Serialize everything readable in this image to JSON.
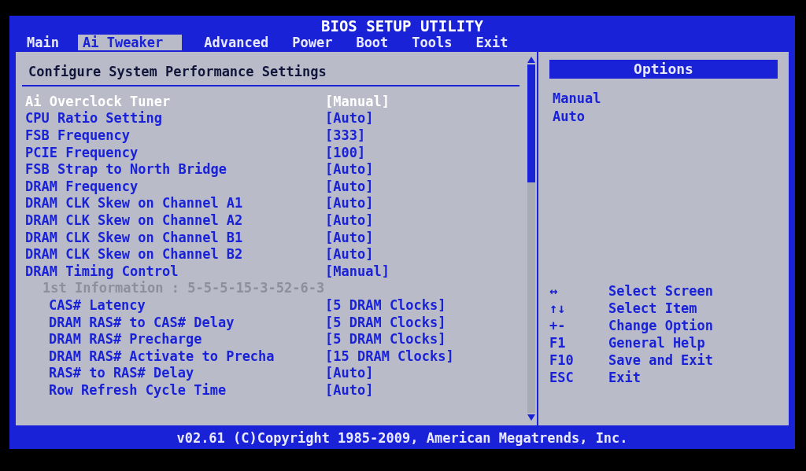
{
  "window": {
    "title": "BIOS SETUP UTILITY"
  },
  "tabs": [
    {
      "label": "Main",
      "selected": false
    },
    {
      "label": "Ai Tweaker",
      "selected": true
    },
    {
      "label": "Advanced",
      "selected": false
    },
    {
      "label": "Power",
      "selected": false
    },
    {
      "label": "Boot",
      "selected": false
    },
    {
      "label": "Tools",
      "selected": false
    },
    {
      "label": "Exit",
      "selected": false
    }
  ],
  "settings_panel": {
    "heading": "Configure System Performance Settings",
    "items": [
      {
        "kind": "setting",
        "label": "Ai Overclock Tuner",
        "value": "[Manual]",
        "selected": true
      },
      {
        "kind": "setting",
        "label": "CPU Ratio Setting",
        "value": "[Auto]",
        "selected": false
      },
      {
        "kind": "setting",
        "label": "FSB Frequency",
        "value": "[333]",
        "selected": false
      },
      {
        "kind": "setting",
        "label": "PCIE Frequency",
        "value": "[100]",
        "selected": false
      },
      {
        "kind": "setting",
        "label": "FSB Strap to North Bridge",
        "value": "[Auto]",
        "selected": false
      },
      {
        "kind": "setting",
        "label": "DRAM Frequency",
        "value": "[Auto]",
        "selected": false
      },
      {
        "kind": "setting",
        "label": "DRAM CLK Skew on Channel A1",
        "value": "[Auto]",
        "selected": false
      },
      {
        "kind": "setting",
        "label": "DRAM CLK Skew on Channel A2",
        "value": "[Auto]",
        "selected": false
      },
      {
        "kind": "setting",
        "label": "DRAM CLK Skew on Channel B1",
        "value": "[Auto]",
        "selected": false
      },
      {
        "kind": "setting",
        "label": "DRAM CLK Skew on Channel B2",
        "value": "[Auto]",
        "selected": false
      },
      {
        "kind": "setting",
        "label": "DRAM Timing Control",
        "value": "[Manual]",
        "selected": false,
        "children": [
          {
            "kind": "info",
            "label": "1st Information : 5-5-5-15-3-52-6-3"
          },
          {
            "kind": "setting",
            "label": "CAS# Latency",
            "value": "[5 DRAM Clocks]",
            "selected": false
          },
          {
            "kind": "setting",
            "label": "DRAM RAS# to CAS# Delay",
            "value": "[5 DRAM Clocks]",
            "selected": false
          },
          {
            "kind": "setting",
            "label": "DRAM RAS# Precharge",
            "value": "[5 DRAM Clocks]",
            "selected": false
          },
          {
            "kind": "setting",
            "label": "DRAM RAS# Activate to Precha",
            "value": "[15 DRAM Clocks]",
            "selected": false
          },
          {
            "kind": "setting",
            "label": "RAS# to RAS# Delay",
            "value": "[Auto]",
            "selected": false
          },
          {
            "kind": "setting",
            "label": "Row Refresh Cycle Time",
            "value": "[Auto]",
            "selected": false
          }
        ]
      }
    ]
  },
  "options_panel": {
    "heading": "Options",
    "options": [
      "Manual",
      "Auto"
    ],
    "help": [
      {
        "key": "↔",
        "action": "Select Screen"
      },
      {
        "key": "↑↓",
        "action": "Select Item"
      },
      {
        "key": "+-",
        "action": "Change Option"
      },
      {
        "key": "F1",
        "action": "General Help"
      },
      {
        "key": "F10",
        "action": "Save and Exit"
      },
      {
        "key": "ESC",
        "action": "Exit"
      }
    ]
  },
  "status_bar": {
    "text": "v02.61 (C)Copyright 1985-2009, American Megatrends, Inc."
  }
}
